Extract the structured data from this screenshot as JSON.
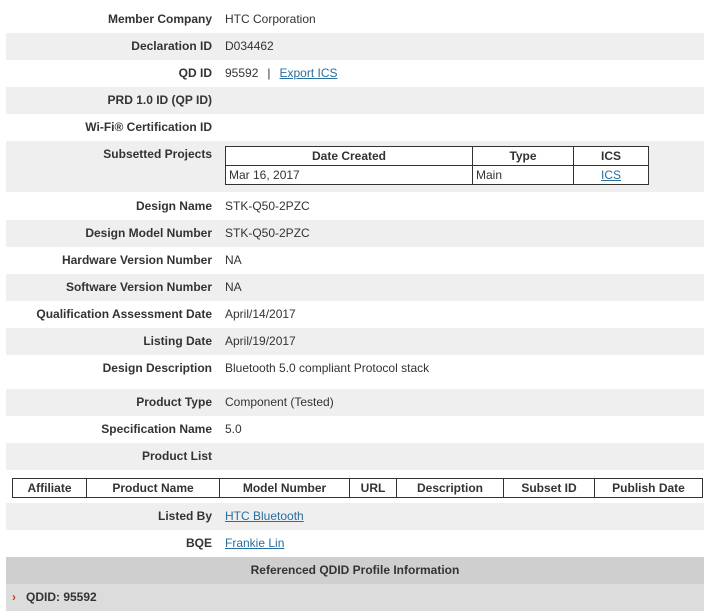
{
  "fields": {
    "member_company": {
      "label": "Member Company",
      "value": "HTC Corporation"
    },
    "declaration_id": {
      "label": "Declaration ID",
      "value": "D034462"
    },
    "qd_id": {
      "label": "QD ID",
      "value": "95592",
      "separator": "|",
      "link": "Export ICS"
    },
    "prd_id": {
      "label": "PRD 1.0 ID (QP ID)",
      "value": ""
    },
    "wifi_cert": {
      "label": "Wi-Fi® Certification ID",
      "value": ""
    },
    "subsetted": {
      "label": "Subsetted Projects"
    },
    "design_name": {
      "label": "Design Name",
      "value": "STK-Q50-2PZC"
    },
    "design_model": {
      "label": "Design Model Number",
      "value": "STK-Q50-2PZC"
    },
    "hw_version": {
      "label": "Hardware Version Number",
      "value": "NA"
    },
    "sw_version": {
      "label": "Software Version Number",
      "value": "NA"
    },
    "qa_date": {
      "label": "Qualification Assessment Date",
      "value": "April/14/2017"
    },
    "listing_date": {
      "label": "Listing Date",
      "value": "April/19/2017"
    },
    "design_desc": {
      "label": "Design Description",
      "value": "Bluetooth 5.0 compliant Protocol stack"
    },
    "product_type": {
      "label": "Product Type",
      "value": "Component (Tested)"
    },
    "spec_name": {
      "label": "Specification Name",
      "value": "5.0"
    },
    "product_list": {
      "label": "Product List"
    },
    "listed_by": {
      "label": "Listed By",
      "value": "HTC Bluetooth"
    },
    "bqe": {
      "label": "BQE",
      "value": "Frankie Lin"
    }
  },
  "subsetted_table": {
    "headers": [
      "Date Created",
      "Type",
      "ICS"
    ],
    "row": {
      "date": "Mar 16, 2017",
      "type": "Main",
      "ics": "ICS"
    }
  },
  "product_table": {
    "headers": [
      "Affiliate",
      "Product Name",
      "Model Number",
      "URL",
      "Description",
      "Subset ID",
      "Publish Date"
    ]
  },
  "referenced": {
    "title": "Referenced QDID Profile Information",
    "qdid_item": "QDID: 95592"
  },
  "colors": {
    "link": "#2a6e9e",
    "alt_row": "#efefef",
    "chevron": "#c4441c"
  },
  "icons": {
    "expand": "chevron-right-icon"
  }
}
